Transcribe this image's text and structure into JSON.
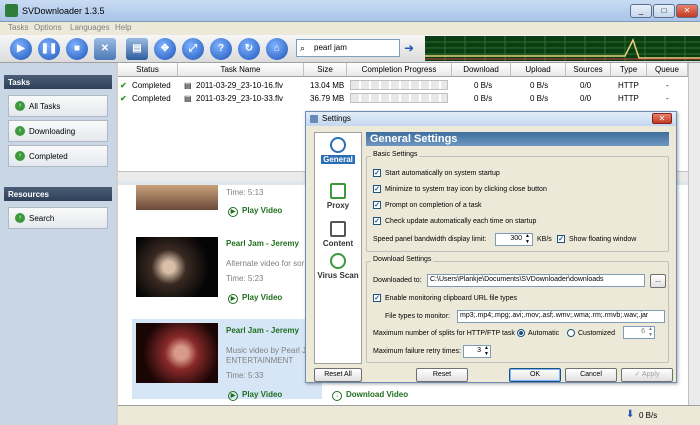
{
  "app": {
    "title": "SVDownloader 1.3.5"
  },
  "window_controls": {
    "minimize": "_",
    "maximize": "□",
    "close": "✕"
  },
  "menu": [
    "Tasks",
    "Options",
    "Languages",
    "Help"
  ],
  "search": {
    "query": "pearl jam"
  },
  "sidebar": {
    "tasks_header": "Tasks",
    "items": [
      "All Tasks",
      "Downloading",
      "Completed"
    ],
    "resources_header": "Resources",
    "resource_items": [
      "Search"
    ]
  },
  "table": {
    "columns": [
      "Status",
      "Task Name",
      "Size",
      "Completion Progress",
      "Download",
      "Upload",
      "Sources",
      "Type",
      "Queue"
    ],
    "rows": [
      {
        "status": "Completed",
        "name": "2011-03-29_23-10-16.flv",
        "size": "13.04 MB",
        "download": "0 B/s",
        "upload": "0 B/s",
        "sources": "0/0",
        "type": "HTTP",
        "queue": "-"
      },
      {
        "status": "Completed",
        "name": "2011-03-29_23-10-33.flv",
        "size": "36.79 MB",
        "download": "0 B/s",
        "upload": "0 B/s",
        "sources": "0/0",
        "type": "HTTP",
        "queue": "-"
      }
    ]
  },
  "results": [
    {
      "time": "Time: 5:13",
      "play": "Play Video"
    },
    {
      "title": "Pearl Jam - Jeremy",
      "desc": "Alternate video for sor",
      "time": "Time: 5:23",
      "play": "Play Video"
    },
    {
      "title": "Pearl Jam - Jeremy",
      "desc": "Music video by Pearl J",
      "desc2": "ENTERTAINMENT",
      "time": "Time: 5:33",
      "play": "Play Video",
      "download": "Download Video"
    }
  ],
  "statusbar": {
    "speed": "0 B/s"
  },
  "dialog": {
    "title": "Settings",
    "nav": [
      "General",
      "Proxy",
      "Content",
      "Virus Scan"
    ],
    "heading": "General Settings",
    "basic": {
      "legend": "Basic Settings",
      "start_startup": "Start automatically on system startup",
      "minimize_tray": "Minimize to system tray icon by clicking close button",
      "prompt_completion": "Prompt on completion of a task",
      "check_update": "Check update automatically each time on startup",
      "bandwidth_label": "Speed panel bandwidth display limit:",
      "bandwidth_value": "300",
      "bandwidth_unit": "KB/s",
      "show_floating": "Show floating window"
    },
    "download": {
      "legend": "Download Settings",
      "downloaded_to_label": "Downloaded to:",
      "downloaded_to_value": "C:\\Users\\Plankje\\Documents\\SVDownloader\\downloads",
      "browse": "...",
      "monitor_clipboard": "Enable monitoring clipboard URL file types",
      "file_types_label": "File types to monitor:",
      "file_types_value": "mp3;.mp4;.mpg;.avi;.mov;.asf;.wmv;.wma;.rm;.rmvb;.wav;.jar",
      "splits_label": "Maximum number of splits for HTTP/FTP task",
      "automatic": "Automatic",
      "customized": "Customized",
      "splits_value": "6",
      "retry_label": "Maximum failure retry times:",
      "retry_value": "3"
    },
    "buttons": {
      "reset_all": "Reset All",
      "reset": "Reset",
      "ok": "OK",
      "cancel": "Cancel",
      "apply": "Apply"
    }
  }
}
